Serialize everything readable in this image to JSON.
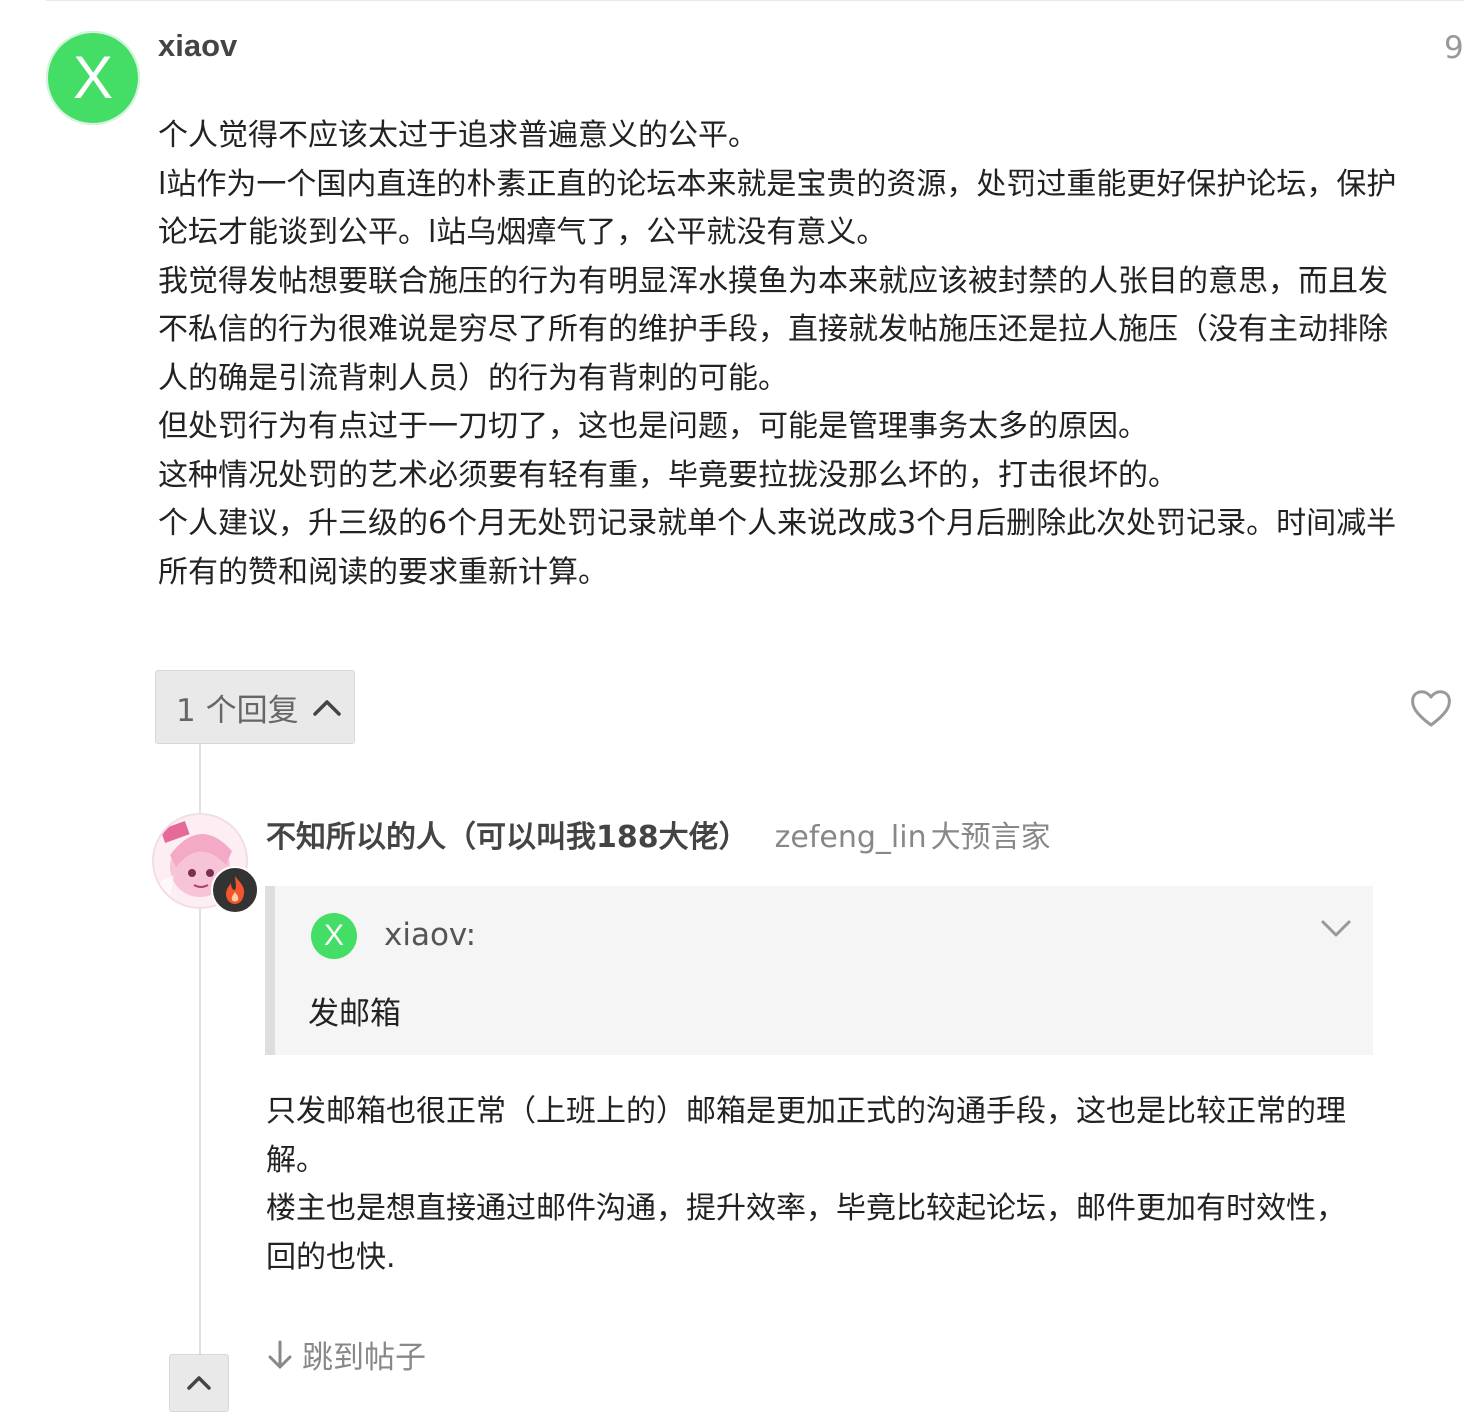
{
  "post": {
    "avatar_letter": "X",
    "avatar_color": "#44dd66",
    "username": "xiaov",
    "date": "9",
    "paragraphs": [
      "个人觉得不应该太过于追求普遍意义的公平。",
      "l站作为一个国内直连的朴素正直的论坛本来就是宝贵的资源，处罚过重能更好保护论坛，保护",
      "论坛才能谈到公平。l站乌烟瘴气了，公平就没有意义。",
      "我觉得发帖想要联合施压的行为有明显浑水摸鱼为本来就应该被封禁的人张目的意思，而且发",
      "不私信的行为很难说是穷尽了所有的维护手段，直接就发帖施压还是拉人施压（没有主动排除",
      "人的确是引流背刺人员）的行为有背刺的可能。",
      "但处罚行为有点过于一刀切了，这也是问题，可能是管理事务太多的原因。",
      "这种情况处罚的艺术必须要有轻有重，毕竟要拉拢没那么坏的，打击很坏的。",
      "个人建议，升三级的6个月无处罚记录就单个人来说改成3个月后删除此次处罚记录。时间减半",
      "所有的赞和阅读的要求重新计算。"
    ]
  },
  "actions": {
    "replies_label": "1 个回复"
  },
  "reply": {
    "name": "不知所以的人（可以叫我188大佬）",
    "username": "zefeng_lin",
    "title": "大预言家",
    "quote": {
      "avatar_letter": "X",
      "username": "xiaov:",
      "text": "发邮箱"
    },
    "paragraphs": [
      "只发邮箱也很正常（上班上的）邮箱是更加正式的沟通手段，这也是比较正常的理解。",
      "楼主也是想直接通过邮件沟通，提升效率，毕竟比较起论坛，邮件更加有时效性，回的也快."
    ],
    "jump_label": "跳到帖子"
  }
}
